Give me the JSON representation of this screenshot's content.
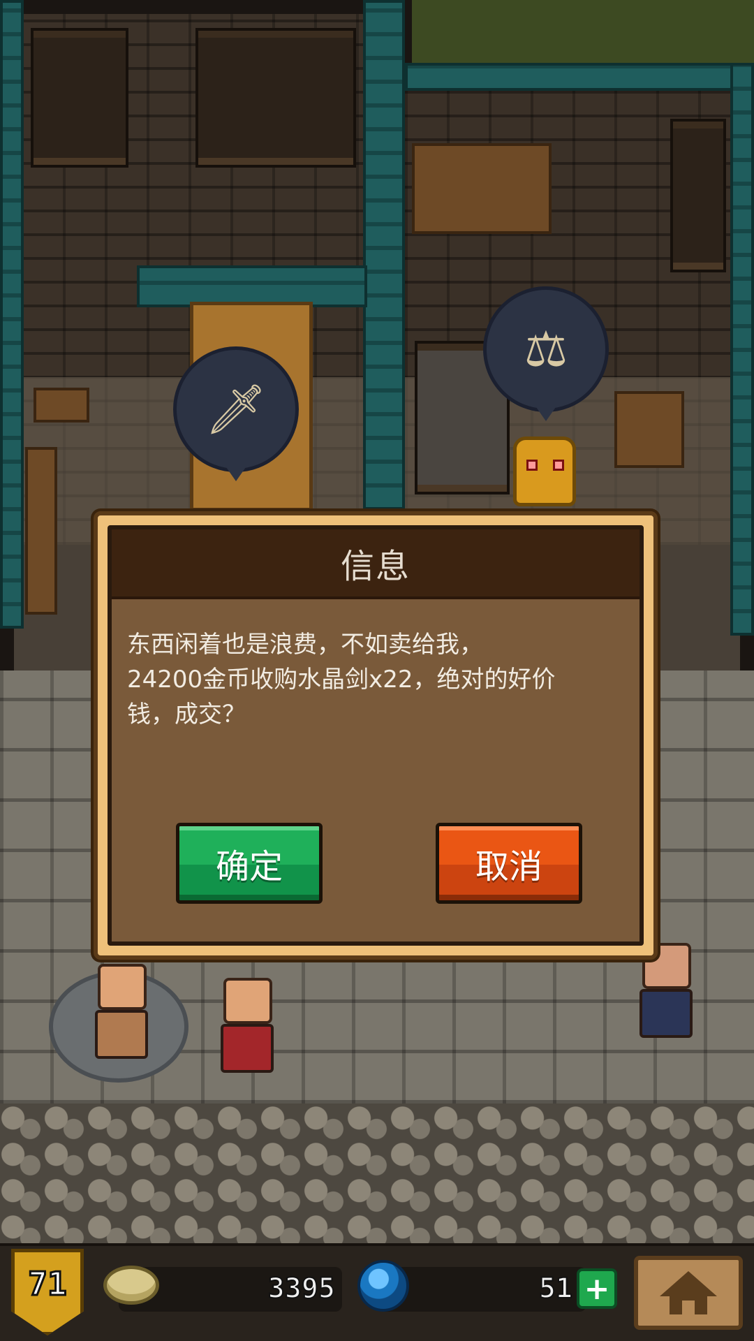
{
  "dialog": {
    "title": "信息",
    "message_line1": "东西闲着也是浪费，不如卖给我，",
    "message_line2": "24200金币收购水晶剑x22，绝对的好价",
    "message_line3": "钱，成交？",
    "confirm_label": "确定",
    "cancel_label": "取消"
  },
  "hud": {
    "level": "71",
    "gold": "3395",
    "gems": "51",
    "add_label": "+"
  },
  "colors": {
    "confirm": "#1fb05a",
    "cancel": "#ea5614",
    "dialog_frame": "#eec07a",
    "dialog_body": "#7a5a3a"
  },
  "icons": {
    "bubble_sword": "sword-icon",
    "bubble_scales": "scales-icon",
    "bubble_axe": "axe-icon",
    "gold": "gold-coin-icon",
    "gem": "blue-gem-icon",
    "home": "home-icon"
  }
}
